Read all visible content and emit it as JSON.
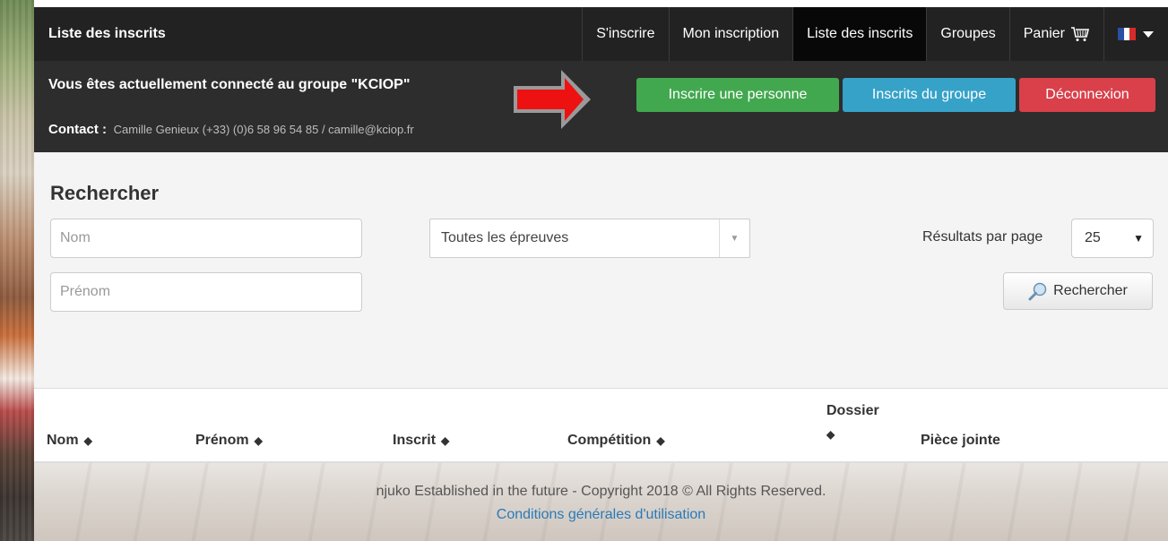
{
  "navbar": {
    "brand": "Liste des inscrits",
    "items": [
      {
        "label": "S'inscrire"
      },
      {
        "label": "Mon inscription"
      },
      {
        "label": "Liste des inscrits"
      },
      {
        "label": "Groupes"
      },
      {
        "label": "Panier"
      }
    ],
    "cart_icon": "cart-icon",
    "language_icon": "flag-fr-icon"
  },
  "group": {
    "title": "Vous êtes actuellement connecté au groupe \"KCIOP\"",
    "contact_label": "Contact :",
    "contact_value": "Camille Genieux (+33) (0)6 58 96 54 85 / camille@kciop.fr",
    "buttons": {
      "add_person": "Inscrire une personne",
      "group_registrants": "Inscrits du groupe",
      "logout": "Déconnexion"
    },
    "colors": {
      "green": "#42a84f",
      "blue": "#36a2c8",
      "red": "#d9404a"
    }
  },
  "search": {
    "title": "Rechercher",
    "nom_placeholder": "Nom",
    "prenom_placeholder": "Prénom",
    "epreuves_value": "Toutes les épreuves",
    "results_label": "Résultats par page",
    "per_page_value": "25",
    "button_label": "Rechercher"
  },
  "table": {
    "columns": [
      "Nom",
      "Prénom",
      "Inscrit",
      "Compétition",
      "Dossier",
      "Pièce jointe"
    ],
    "sort_icon": "⬍"
  },
  "footer": {
    "copyright": "njuko Established in the future - Copyright 2018 © All Rights Reserved.",
    "terms_link": "Conditions générales d'utilisation"
  }
}
